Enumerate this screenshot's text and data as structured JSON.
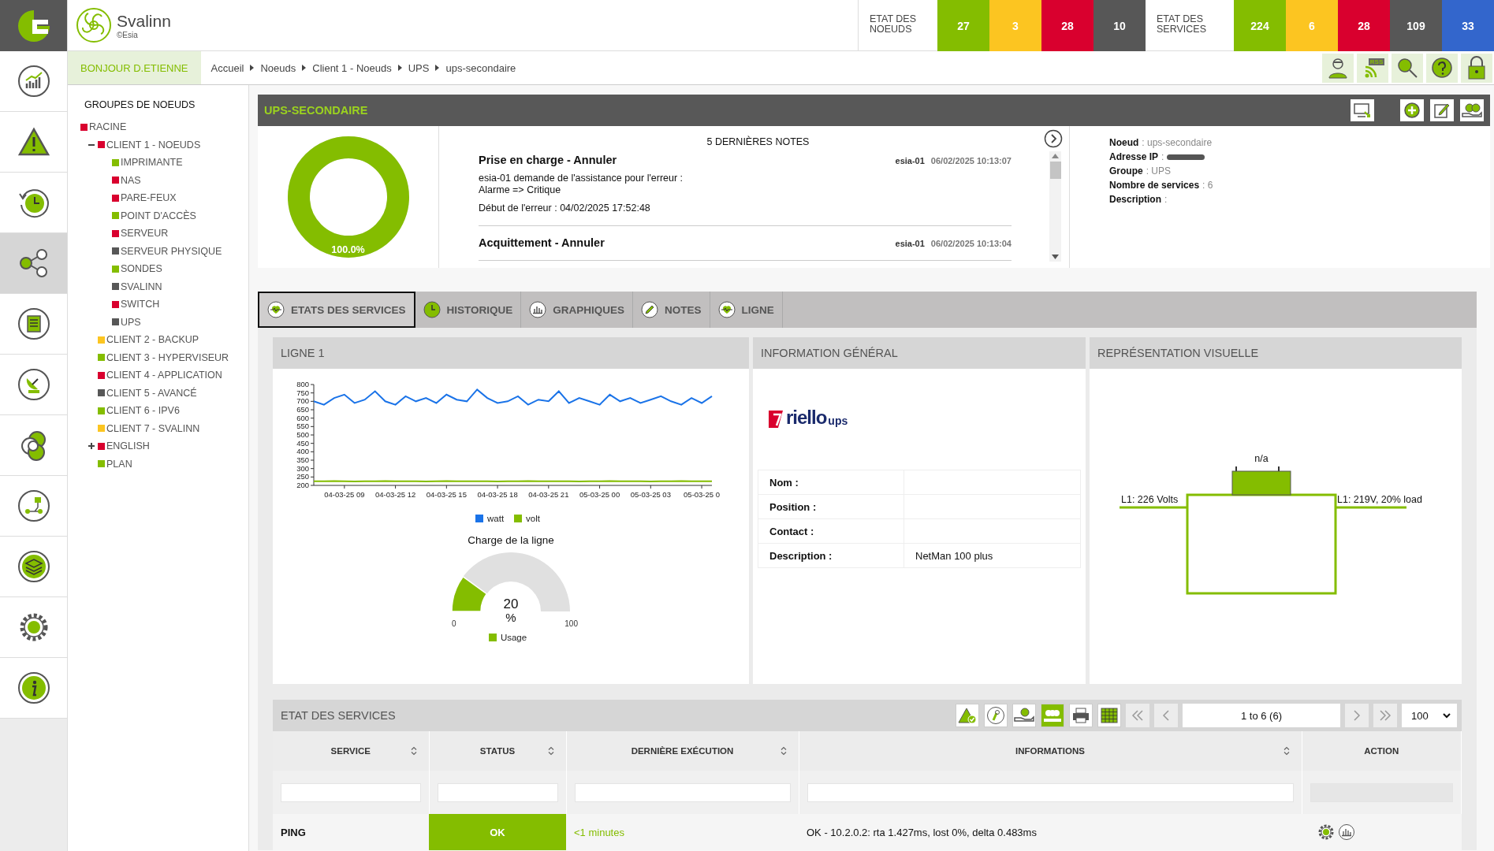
{
  "brand": {
    "name": "Svalinn",
    "copyright": "©Esia"
  },
  "node_states": {
    "label": "ETAT DES NOEUDS",
    "counts": [
      {
        "value": "27",
        "color": "#84bd00"
      },
      {
        "value": "3",
        "color": "#fcc521"
      },
      {
        "value": "28",
        "color": "#d9002e"
      },
      {
        "value": "10",
        "color": "#575757"
      }
    ]
  },
  "service_states": {
    "label": "ETAT DES SERVICES",
    "counts": [
      {
        "value": "224",
        "color": "#84bd00"
      },
      {
        "value": "6",
        "color": "#fcc521"
      },
      {
        "value": "28",
        "color": "#d9002e"
      },
      {
        "value": "109",
        "color": "#575757"
      },
      {
        "value": "33",
        "color": "#3366cc"
      }
    ]
  },
  "greeting": "BONJOUR D.ETIENNE",
  "breadcrumb": [
    "Accueil",
    "Noeuds",
    "Client 1 - Noeuds",
    "UPS",
    "ups-secondaire"
  ],
  "toolbar": {
    "rss_label": "RSS"
  },
  "nav": [
    {
      "selected": false
    },
    {
      "selected": false
    },
    {
      "selected": false
    },
    {
      "selected": true
    },
    {
      "selected": false
    },
    {
      "selected": false
    },
    {
      "selected": false
    },
    {
      "selected": false
    },
    {
      "selected": false
    },
    {
      "selected": false
    },
    {
      "selected": false
    }
  ],
  "tree": {
    "title": "GROUPES DE NOEUDS",
    "items": [
      {
        "label": "RACINE",
        "color": "#d9002e",
        "children": [
          {
            "label": "CLIENT 1 - NOEUDS",
            "color": "#d9002e",
            "expanded": true,
            "children": [
              {
                "label": "IMPRIMANTE",
                "color": "#84bd00"
              },
              {
                "label": "NAS",
                "color": "#d9002e"
              },
              {
                "label": "PARE-FEUX",
                "color": "#d9002e"
              },
              {
                "label": "POINT D'ACCÈS",
                "color": "#84bd00"
              },
              {
                "label": "SERVEUR",
                "color": "#d9002e"
              },
              {
                "label": "SERVEUR PHYSIQUE",
                "color": "#575757"
              },
              {
                "label": "SONDES",
                "color": "#84bd00"
              },
              {
                "label": "SVALINN",
                "color": "#575757"
              },
              {
                "label": "SWITCH",
                "color": "#d9002e"
              },
              {
                "label": "UPS",
                "color": "#575757"
              }
            ]
          },
          {
            "label": "CLIENT 2 - BACKUP",
            "color": "#fcc521"
          },
          {
            "label": "CLIENT 3 - HYPERVISEUR",
            "color": "#84bd00"
          },
          {
            "label": "CLIENT 4 - APPLICATION",
            "color": "#d9002e"
          },
          {
            "label": "CLIENT 5 - AVANCÉ",
            "color": "#575757"
          },
          {
            "label": "CLIENT 6 - IPV6",
            "color": "#84bd00"
          },
          {
            "label": "CLIENT 7 - SVALINN",
            "color": "#fcc521"
          },
          {
            "label": "ENGLISH",
            "color": "#d9002e",
            "expanded": false
          },
          {
            "label": "PLAN",
            "color": "#84bd00"
          }
        ]
      }
    ]
  },
  "node": {
    "title": "UPS-SECONDAIRE",
    "availability": {
      "level": 1,
      "reading": "100.0%"
    },
    "notes": {
      "title": "5 DERNIÈRES NOTES",
      "items": [
        {
          "title": "Prise en charge - Annuler",
          "author": "esia-01",
          "date": "06/02/2025 10:13:07",
          "body": [
            "esia-01 demande de l'assistance pour l'erreur :\nAlarme => Critique",
            "Début de l'erreur : 04/02/2025 17:52:48"
          ]
        },
        {
          "title": "Acquittement - Annuler",
          "author": "esia-01",
          "date": "06/02/2025 10:13:04"
        }
      ]
    },
    "info": [
      {
        "label": "Noeud",
        "value": ": ups-secondaire"
      },
      {
        "label": "Adresse IP",
        "value": ":",
        "redacted": true
      },
      {
        "label": "Groupe",
        "value": ": UPS"
      },
      {
        "label": "Nombre de services",
        "value": ": 6"
      },
      {
        "label": "Description",
        "value": ":"
      }
    ]
  },
  "tabs": [
    {
      "label": "ETATS DES SERVICES",
      "selected": true
    },
    {
      "label": "HISTORIQUE",
      "selected": false
    },
    {
      "label": "GRAPHIQUES",
      "selected": false
    },
    {
      "label": "NOTES",
      "selected": false
    },
    {
      "label": "LIGNE",
      "selected": false
    }
  ],
  "line_panel": {
    "title": "LIGNE 1",
    "chart_data": {
      "type": "line",
      "categories": [
        null,
        null,
        null,
        "04-03-25 09",
        null,
        null,
        null,
        null,
        "04-03-25 12",
        null,
        null,
        null,
        null,
        "04-03-25 15",
        null,
        null,
        null,
        null,
        "04-03-25 18",
        null,
        null,
        null,
        null,
        "04-03-25 21",
        null,
        null,
        null,
        null,
        "05-03-25 00",
        null,
        null,
        null,
        null,
        "05-03-25 03",
        null,
        null,
        null,
        null,
        "05-03-25 0",
        null
      ],
      "ylim": [
        200,
        800
      ],
      "series": [
        {
          "name": "watt",
          "color": "#1a73e8",
          "values": [
            700,
            680,
            720,
            740,
            690,
            710,
            760,
            700,
            680,
            730,
            700,
            720,
            690,
            740,
            710,
            700,
            770,
            720,
            690,
            700,
            730,
            680,
            710,
            700,
            760,
            690,
            720,
            700,
            680,
            740,
            700,
            720,
            690,
            710,
            730,
            700,
            680,
            720,
            690,
            730
          ]
        },
        {
          "name": "volt",
          "color": "#84bd00",
          "values": [
            225,
            225,
            226,
            225,
            224,
            225,
            225,
            226,
            225,
            225,
            225,
            224,
            225,
            226,
            225,
            225,
            225,
            225,
            224,
            225,
            225,
            226,
            225,
            225,
            225,
            225,
            224,
            225,
            225,
            226,
            225,
            225,
            225,
            224,
            225,
            225,
            226,
            225,
            225,
            225
          ]
        }
      ],
      "yticks": [
        200,
        250,
        300,
        350,
        400,
        450,
        500,
        550,
        600,
        650,
        700,
        750,
        800
      ]
    },
    "gauge": {
      "title": "Charge de la ligne",
      "level": 0.2,
      "value": "20",
      "unit": "%",
      "min": "0",
      "max": "100",
      "legend": "Usage"
    }
  },
  "info_panel": {
    "title": "INFORMATION GÉNÉRAL",
    "logo": {
      "name": "riello",
      "suffix": "ups"
    },
    "fields": [
      {
        "label": "Nom :"
      },
      {
        "label": "Position :"
      },
      {
        "label": "Contact :"
      },
      {
        "label": "Description :",
        "value": "NetMan 100 plus"
      }
    ]
  },
  "visual_panel": {
    "title": "REPRÉSENTATION VISUELLE",
    "device": "n/a",
    "input": "L1: 226 Volts",
    "output": "L1: 219V, 20% load"
  },
  "services": {
    "title": "ETAT DES SERVICES",
    "tools": [
      {
        "selected": false
      },
      {
        "selected": false
      },
      {
        "selected": false
      },
      {
        "selected": true
      },
      {
        "selected": false
      },
      {
        "selected": false
      }
    ],
    "pager": {
      "range": "1 to 6 (6)",
      "per_page": "100"
    },
    "columns": [
      {
        "label": "SERVICE",
        "sortable": true
      },
      {
        "label": "STATUS",
        "sortable": true
      },
      {
        "label": "DERNIÈRE EXÉCUTION",
        "sortable": true
      },
      {
        "label": "INFORMATIONS",
        "sortable": true
      },
      {
        "label": "ACTION",
        "sortable": false
      }
    ],
    "rows": [
      {
        "service": "PING",
        "status": "OK",
        "kind": "ok",
        "last_run": "<1 minutes",
        "info": "OK - 10.2.0.2: rta 1.427ms, lost 0%, delta 0.483ms"
      }
    ]
  }
}
